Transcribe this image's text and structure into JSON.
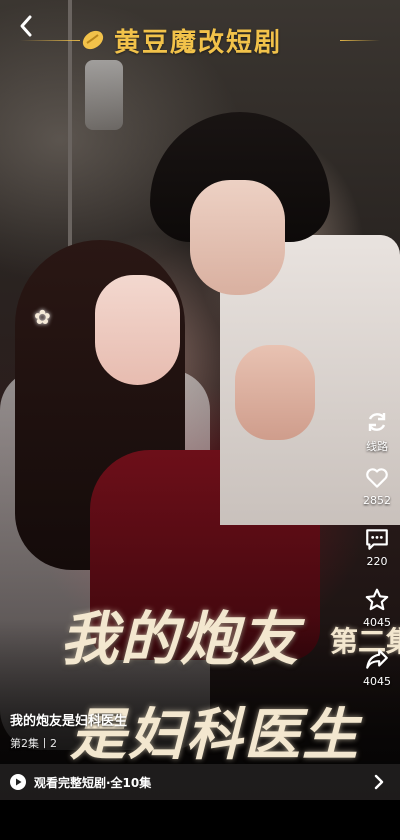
{
  "brand": {
    "name": "黄豆魔改短剧",
    "color": "#f2c24a",
    "logo_icon": "bean-logo"
  },
  "poster": {
    "title_line1": "我的炮友",
    "title_line2": "是妇科医生",
    "season": "第二集"
  },
  "actions": [
    {
      "icon": "refresh-icon",
      "label": "线路"
    },
    {
      "icon": "heart-icon",
      "label": "2852"
    },
    {
      "icon": "comment-icon",
      "label": "220"
    },
    {
      "icon": "star-icon",
      "label": "4045"
    },
    {
      "icon": "share-icon",
      "label": "4045"
    }
  ],
  "info": {
    "drama_title": "我的炮友是妇科医生",
    "episode": "第2集丨2"
  },
  "watch_bar": {
    "label": "观看完整短剧·全10集"
  }
}
